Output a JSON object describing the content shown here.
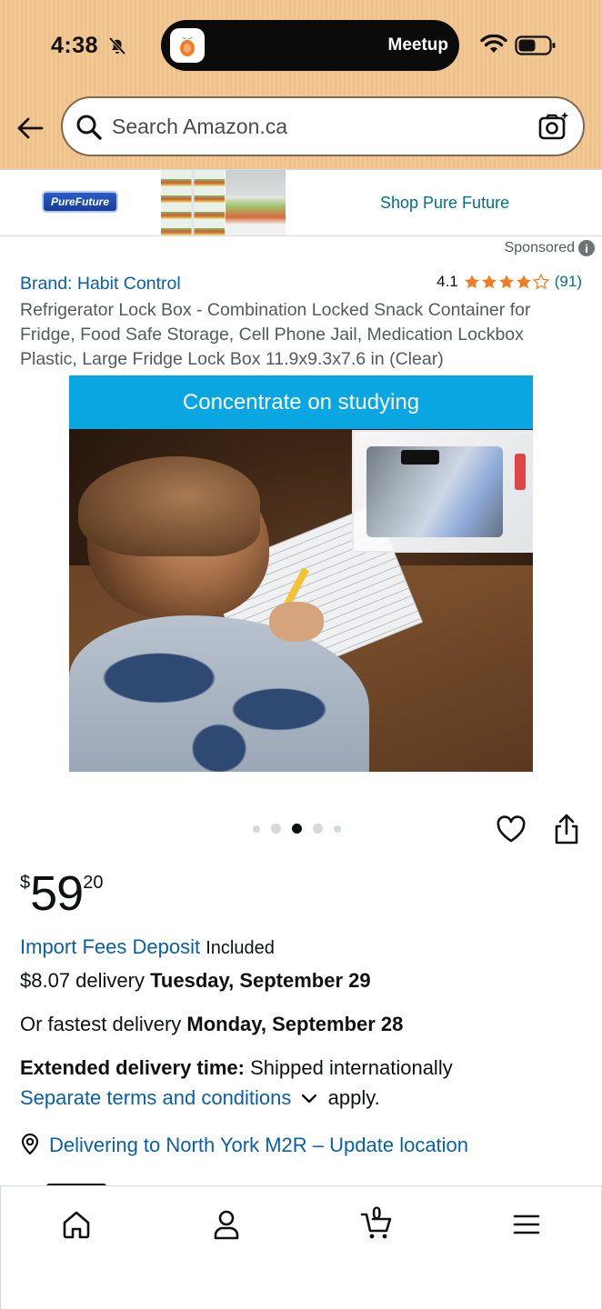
{
  "status_bar": {
    "time": "4:38",
    "live_activity_label": "Meetup",
    "icons": [
      "bell-slash-icon",
      "wifi-icon",
      "battery-icon"
    ]
  },
  "search": {
    "placeholder": "Search Amazon.ca"
  },
  "sponsored_banner": {
    "logo_text": "PureFuture",
    "cta": "Shop Pure Future",
    "label": "Sponsored"
  },
  "product": {
    "brand_line": "Brand: Habit Control",
    "rating_value": "4.1",
    "rating_stars": 4.1,
    "rating_count": "(91)",
    "title": "Refrigerator Lock Box - Combination Locked Snack Container for Fridge, Food Safe Storage, Cell Phone Jail, Medication Lockbox Plastic, Large Fridge Lock Box 11.9x9.3x7.6 in (Clear)",
    "image_caption": "Concentrate on studying",
    "carousel": {
      "total": 5,
      "active_index": 2
    }
  },
  "price": {
    "symbol": "$",
    "whole": "59",
    "fraction": "20"
  },
  "delivery": {
    "import_fees_link": "Import Fees Deposit",
    "import_fees_suffix": "Included",
    "standard_prefix": "$8.07 delivery",
    "standard_date": "Tuesday, September 29",
    "fastest_prefix": "Or fastest delivery",
    "fastest_date": "Monday, September 28",
    "extended_label": "Extended delivery time:",
    "extended_text": "Shipped internationally",
    "terms_link": "Separate terms and conditions",
    "terms_suffix": "apply.",
    "location_link": "Delivering to North York M2R – Update location"
  },
  "tabbar": {
    "cart_count": "0",
    "tabs": [
      "home-icon",
      "account-icon",
      "cart-icon",
      "menu-icon"
    ]
  },
  "colors": {
    "header_bg": "#f1c894",
    "link": "#0b5ea8",
    "teal_link": "#007185",
    "star": "#f57a20",
    "image_banner": "#0aa6e2"
  }
}
